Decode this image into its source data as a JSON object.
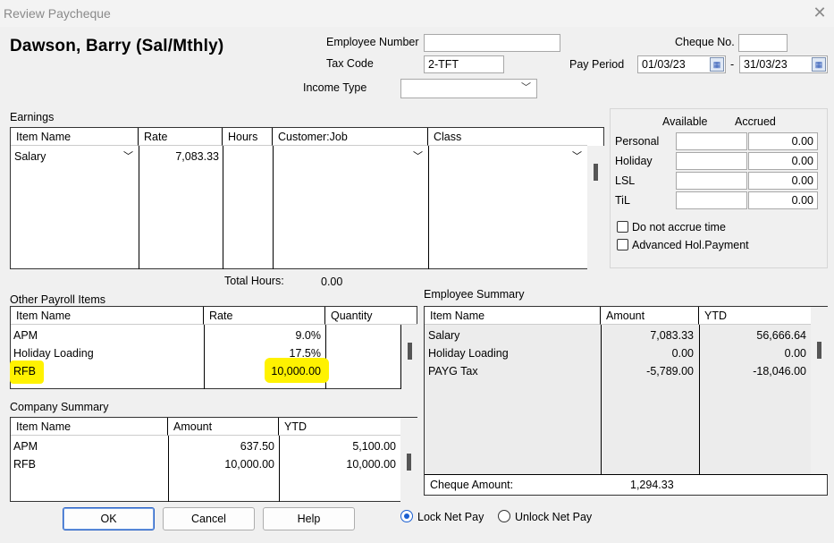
{
  "window": {
    "title": "Review Paycheque",
    "close_glyph": "✕"
  },
  "employee": {
    "name": "Dawson, Barry (Sal/Mthly)"
  },
  "fields": {
    "employee_number_label": "Employee Number",
    "employee_number": "",
    "tax_code_label": "Tax Code",
    "tax_code": "2-TFT",
    "income_type_label": "Income Type",
    "income_type": "",
    "cheque_no_label": "Cheque No.",
    "cheque_no": "",
    "pay_period_label": "Pay Period",
    "pay_period_from": "01/03/23",
    "pay_period_sep": "-",
    "pay_period_to": "31/03/23"
  },
  "earnings": {
    "label": "Earnings",
    "columns": [
      "Item Name",
      "Rate",
      "Hours",
      "Customer:Job",
      "Class"
    ],
    "rows": [
      {
        "item": "Salary",
        "rate": "7,083.33",
        "hours": "",
        "customer_job": "",
        "class": ""
      }
    ],
    "total_hours_label": "Total Hours:",
    "total_hours": "0.00"
  },
  "leave": {
    "available_label": "Available",
    "accrued_label": "Accrued",
    "rows": [
      {
        "name": "Personal",
        "available": "",
        "accrued": "0.00"
      },
      {
        "name": "Holiday",
        "available": "",
        "accrued": "0.00"
      },
      {
        "name": "LSL",
        "available": "",
        "accrued": "0.00"
      },
      {
        "name": "TiL",
        "available": "",
        "accrued": "0.00"
      }
    ],
    "do_not_accrue_label": "Do not accrue time",
    "advanced_hol_label": "Advanced Hol.Payment"
  },
  "other_payroll": {
    "label": "Other Payroll Items",
    "columns": [
      "Item Name",
      "Rate",
      "Quantity"
    ],
    "rows": [
      {
        "item": "APM",
        "rate": "9.0%",
        "quantity": ""
      },
      {
        "item": "Holiday Loading",
        "rate": "17.5%",
        "quantity": ""
      },
      {
        "item": "RFB",
        "rate": "10,000.00",
        "quantity": ""
      }
    ]
  },
  "company_summary": {
    "label": "Company Summary",
    "columns": [
      "Item Name",
      "Amount",
      "YTD"
    ],
    "rows": [
      {
        "item": "APM",
        "amount": "637.50",
        "ytd": "5,100.00"
      },
      {
        "item": "RFB",
        "amount": "10,000.00",
        "ytd": "10,000.00"
      }
    ]
  },
  "employee_summary": {
    "label": "Employee Summary",
    "columns": [
      "Item Name",
      "Amount",
      "YTD"
    ],
    "rows": [
      {
        "item": "Salary",
        "amount": "7,083.33",
        "ytd": "56,666.64"
      },
      {
        "item": "Holiday Loading",
        "amount": "0.00",
        "ytd": "0.00"
      },
      {
        "item": "PAYG Tax",
        "amount": "-5,789.00",
        "ytd": "-18,046.00"
      }
    ],
    "cheque_amount_label": "Cheque Amount:",
    "cheque_amount": "1,294.33"
  },
  "buttons": {
    "ok": "OK",
    "cancel": "Cancel",
    "help": "Help"
  },
  "net_pay": {
    "lock_label": "Lock Net Pay",
    "unlock_label": "Unlock Net Pay",
    "selected": "lock"
  },
  "colors": {
    "highlight": "#fff200",
    "accent": "#1a5fd1"
  },
  "icons": {
    "calendar": "calendar-icon",
    "dropdown": "chevron-down-icon",
    "close": "close-icon"
  }
}
